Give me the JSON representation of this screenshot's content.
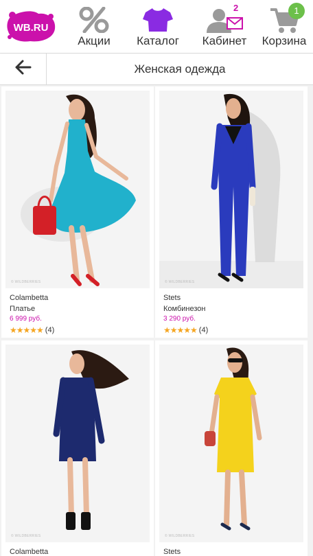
{
  "header": {
    "logo_text": "WB.RU",
    "nav": [
      {
        "label": "Акции",
        "icon": "percent-icon"
      },
      {
        "label": "Каталог",
        "icon": "tshirt-icon"
      },
      {
        "label": "Кабинет",
        "icon": "user-mail-icon",
        "badge": "2"
      },
      {
        "label": "Корзина",
        "icon": "cart-icon",
        "badge": "1"
      }
    ]
  },
  "subheader": {
    "back_icon": "arrow-left-icon",
    "title": "Женская одежда"
  },
  "products": [
    {
      "brand": "Colambetta",
      "name": "Платье",
      "price": "6 999 руб.",
      "stars": "★★★★★",
      "reviews": "(4)",
      "watermark": "© WILDBERRIES",
      "colors": {
        "garment": "#21b1cc",
        "accent": "#d32027"
      }
    },
    {
      "brand": "Stets",
      "name": "Комбинезон",
      "price": "3 290 руб.",
      "stars": "★★★★★",
      "reviews": "(4)",
      "watermark": "© WILDBERRIES",
      "colors": {
        "garment": "#2a3bbd",
        "accent": "#111111"
      }
    },
    {
      "brand": "Colambetta",
      "watermark": "© WILDBERRIES",
      "colors": {
        "garment": "#1d2a6e",
        "accent": "#111111"
      }
    },
    {
      "brand": "Stets",
      "watermark": "© WILDBERRIES",
      "colors": {
        "garment": "#f4d21c",
        "accent": "#c8453a"
      }
    }
  ],
  "colors": {
    "brand": "#cb11ab",
    "price": "#cb11ab",
    "cart_badge": "#6cc04a",
    "icon_gray": "#9a9a9a",
    "star": "#f5a623"
  }
}
